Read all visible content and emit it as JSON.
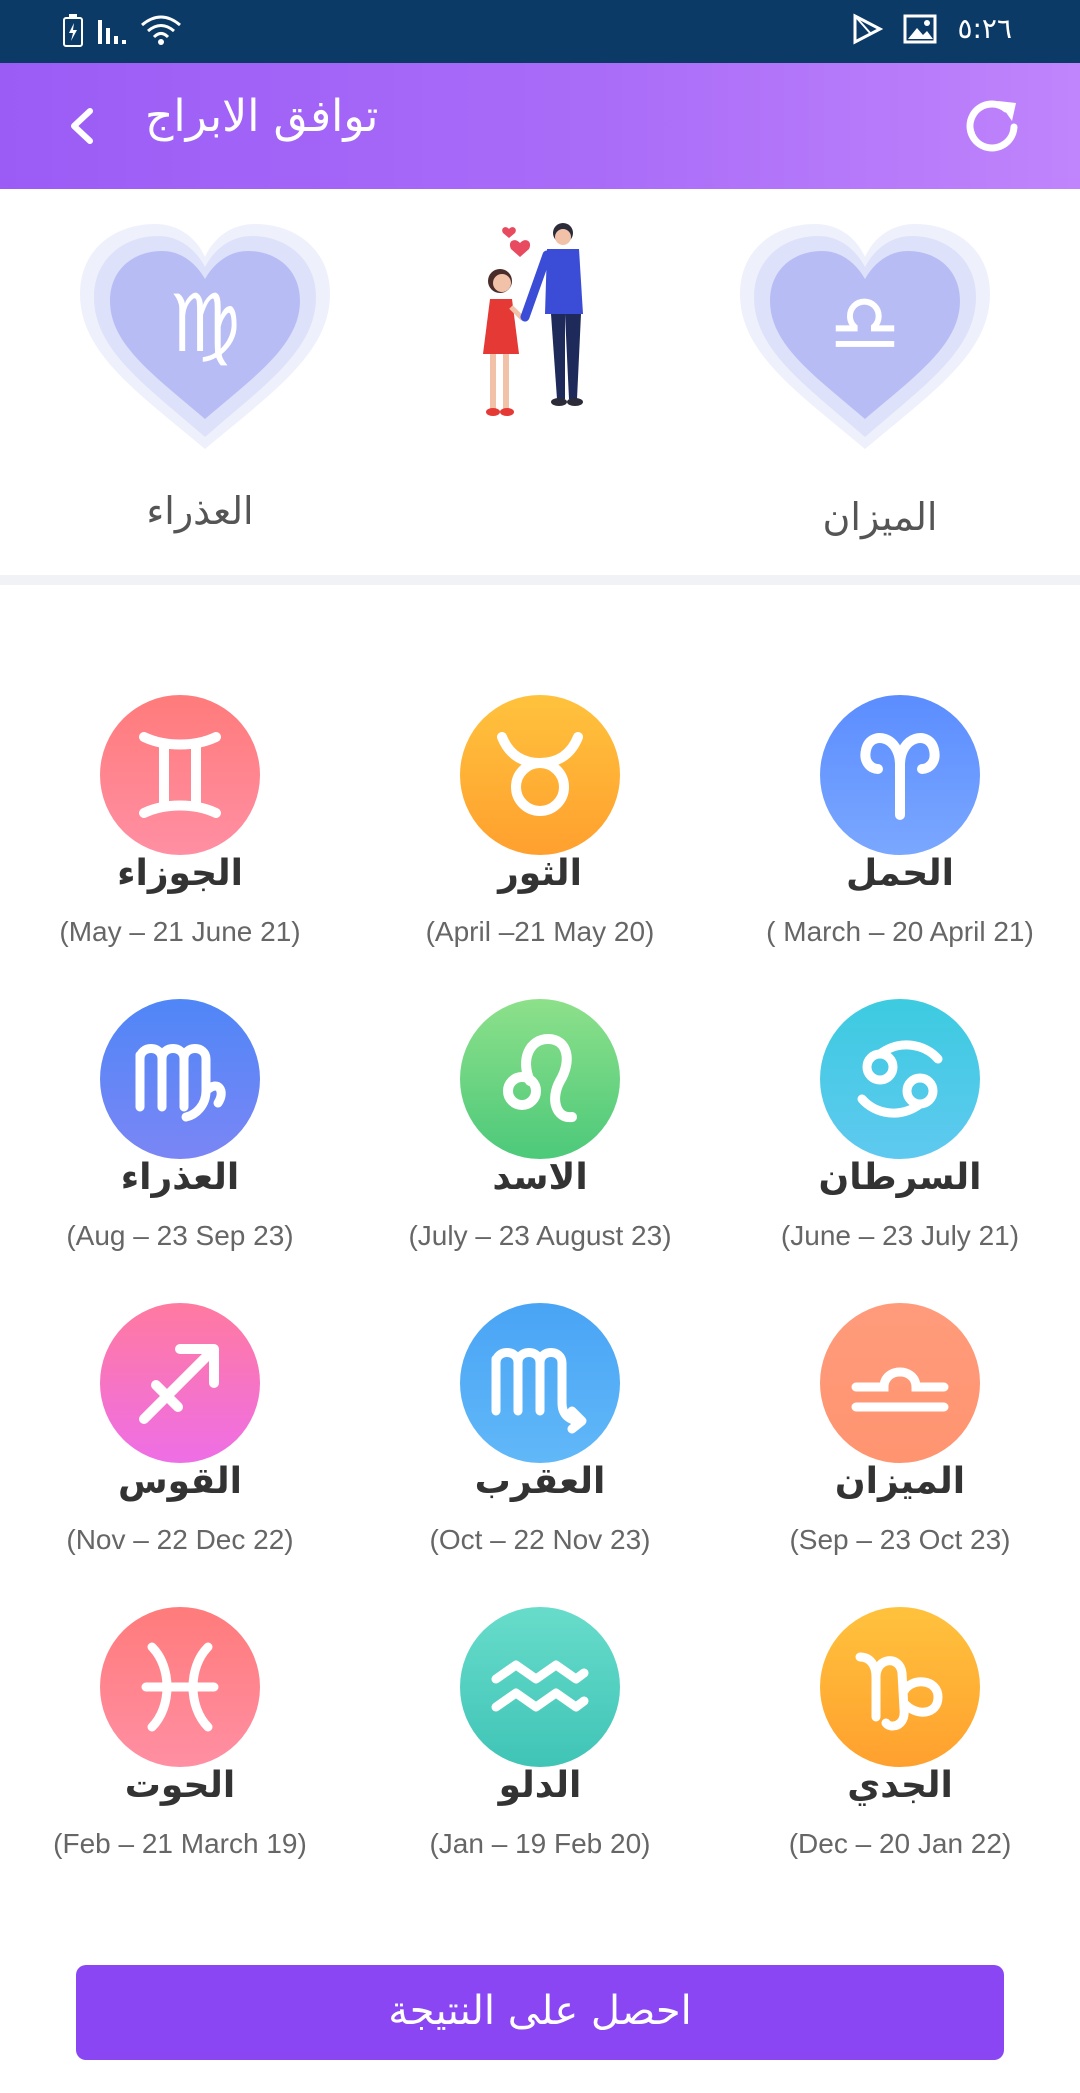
{
  "status_bar": {
    "time": "٥:٢٦",
    "icons": [
      "battery-charging-icon",
      "signal-icon",
      "wifi-icon",
      "play-store-icon",
      "image-icon"
    ]
  },
  "header": {
    "title": "توافق الابراج",
    "back_icon": "chevron-left-icon",
    "refresh_icon": "refresh-icon",
    "gradient_start": "#9b5cf6",
    "gradient_end": "#c084fc"
  },
  "selection": {
    "first_label": "العذراء",
    "first_symbol": "♍",
    "second_label": "الميزان",
    "second_symbol": "♎",
    "heart_color": "#b7bdf4"
  },
  "signs": [
    {
      "name": "الحمل",
      "dates": "( March – 20 April 21)",
      "symbol": "aries",
      "color_top": "#5b8dff",
      "color_bottom": "#7aa7ff"
    },
    {
      "name": "الثور",
      "dates": "(April –21 May 20)",
      "symbol": "taurus",
      "color_top": "#ffc23d",
      "color_bottom": "#ffa02e"
    },
    {
      "name": "الجوزاء",
      "dates": "(May – 21 June 21)",
      "symbol": "gemini",
      "color_top": "#ff7b7b",
      "color_bottom": "#ff8fa3"
    },
    {
      "name": "السرطان",
      "dates": "(June – 23 July 21)",
      "symbol": "cancer",
      "color_top": "#3ccbe0",
      "color_bottom": "#5fc9f0"
    },
    {
      "name": "الاسد",
      "dates": "(July – 23 August 23)",
      "symbol": "leo",
      "color_top": "#8de08a",
      "color_bottom": "#4cc97a"
    },
    {
      "name": "العذراء",
      "dates": "(Aug – 23 Sep 23)",
      "symbol": "virgo",
      "color_top": "#4f86f7",
      "color_bottom": "#7b86f5"
    },
    {
      "name": "الميزان",
      "dates": "(Sep – 23 Oct 23)",
      "symbol": "libra",
      "color_top": "#ff9b7b",
      "color_bottom": "#ff9470"
    },
    {
      "name": "العقرب",
      "dates": "(Oct – 22 Nov 23)",
      "symbol": "scorpio",
      "color_top": "#49a4f5",
      "color_bottom": "#61b8f8"
    },
    {
      "name": "القوس",
      "dates": "(Nov – 22 Dec 22)",
      "symbol": "sagittarius",
      "color_top": "#ff7aa0",
      "color_bottom": "#ee6ee6"
    },
    {
      "name": "الجدي",
      "dates": "(Dec – 20 Jan 22)",
      "symbol": "capricorn",
      "color_top": "#ffc23d",
      "color_bottom": "#ffa02e"
    },
    {
      "name": "الدلو",
      "dates": "(Jan – 19 Feb 20)",
      "symbol": "aquarius",
      "color_top": "#68dccb",
      "color_bottom": "#3fc4b6"
    },
    {
      "name": "الحوت",
      "dates": "(Feb – 21 March 19)",
      "symbol": "pisces",
      "color_top": "#ff7b7b",
      "color_bottom": "#ff8fa3"
    }
  ],
  "result_button": {
    "label": "احصل على النتيجة",
    "color": "#8b46f4"
  }
}
